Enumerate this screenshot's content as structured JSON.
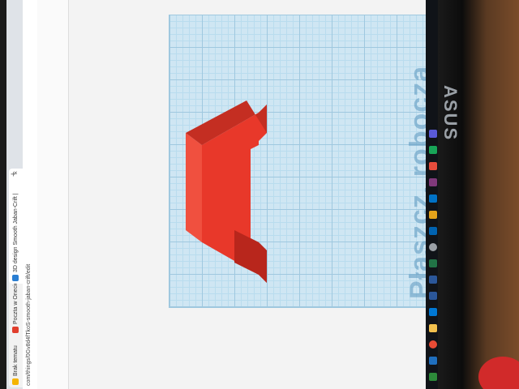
{
  "browser": {
    "tabs": [
      {
        "label": "Brak tematu",
        "color": "#f5b400"
      },
      {
        "label": "Poczta w Onecie",
        "color": "#e03e2d"
      },
      {
        "label": "3D design Smooth Jaban-Crift |",
        "color": "#2a7ed2"
      }
    ],
    "new_tab_label": "+",
    "close_label": "×",
    "url": "com/things/0Gv8d4fTkoS-smooth-jaban-crift/edit"
  },
  "workplane": {
    "label": "Płaszcz. robocza",
    "grid_color": "#9fc8df",
    "plane_color": "#cfe6f3"
  },
  "shape": {
    "color_front": "#e8382a",
    "color_side": "#b8261c",
    "color_top": "#f0503f"
  },
  "monitor": {
    "brand": "ASUS"
  },
  "taskbar": {
    "icons": [
      "start-icon",
      "cortana-icon",
      "chrome-icon",
      "file-explorer-icon",
      "mail-icon",
      "store-icon",
      "word-icon",
      "excel-icon",
      "settings-icon",
      "photos-icon",
      "explorer-icon",
      "outlook-icon",
      "onenote-icon",
      "teams-icon"
    ]
  }
}
